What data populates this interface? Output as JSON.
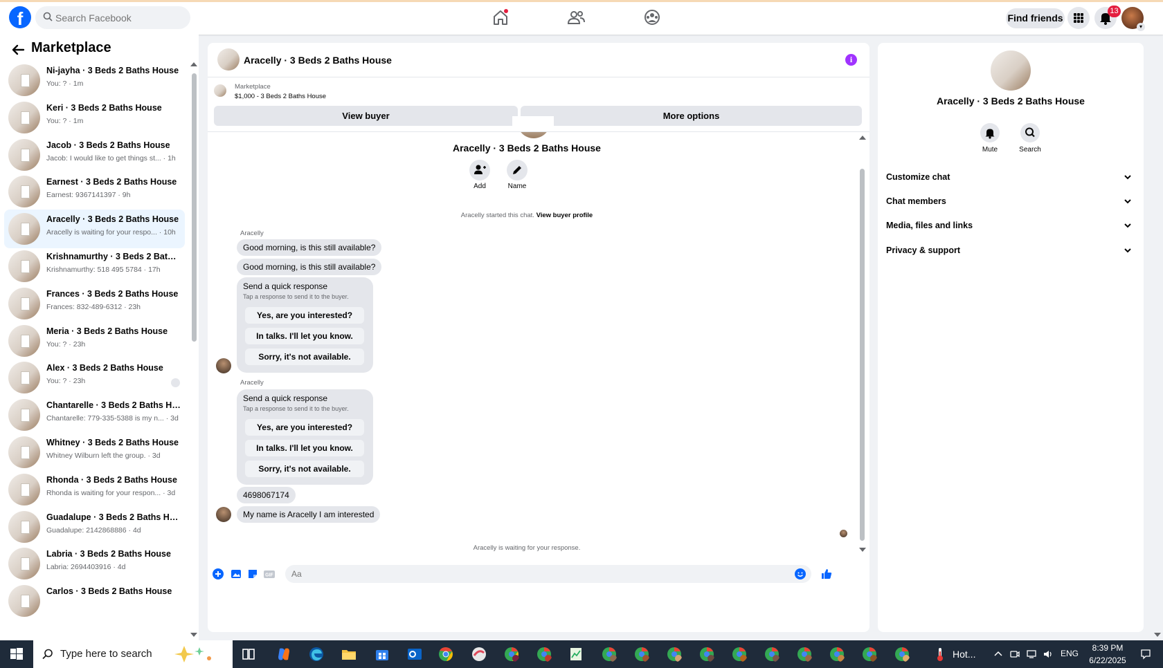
{
  "topbar": {
    "search_placeholder": "Search Facebook",
    "find_friends": "Find friends",
    "notification_count": "13",
    "brand_color": "#0866ff"
  },
  "sidebar": {
    "title": "Marketplace",
    "conversations": [
      {
        "title": "Ni-jayha · 3 Beds 2 Baths House",
        "subtitle": "You: ? · 1m"
      },
      {
        "title": "Keri · 3 Beds 2 Baths House",
        "subtitle": "You: ? · 1m"
      },
      {
        "title": "Jacob · 3 Beds 2 Baths House",
        "subtitle": "Jacob: I would like to get things st... · 1h"
      },
      {
        "title": "Earnest · 3 Beds 2 Baths House",
        "subtitle": "Earnest: 9367141397 · 9h"
      },
      {
        "title": "Aracelly · 3 Beds 2 Baths House",
        "subtitle": "Aracelly is waiting for your respo... · 10h"
      },
      {
        "title": "Krishnamurthy · 3 Beds 2 Baths ...",
        "subtitle": "Krishnamurthy: 518 495 5784 · 17h"
      },
      {
        "title": "Frances · 3 Beds 2 Baths House",
        "subtitle": "Frances: 832-489-6312 · 23h"
      },
      {
        "title": "Meria · 3 Beds 2 Baths House",
        "subtitle": "You: ? · 23h"
      },
      {
        "title": "Alex · 3 Beds 2 Baths House",
        "subtitle": "You: ? · 23h"
      },
      {
        "title": "Chantarelle · 3 Beds 2 Baths Ho...",
        "subtitle": "Chantarelle: 779-335-5388 is my n... · 3d"
      },
      {
        "title": "Whitney · 3 Beds 2 Baths House",
        "subtitle": "Whitney Wilburn left the group. · 3d"
      },
      {
        "title": "Rhonda · 3 Beds 2 Baths House",
        "subtitle": "Rhonda is waiting for your respon... · 3d"
      },
      {
        "title": "Guadalupe · 3 Beds 2 Baths Ho...",
        "subtitle": "Guadalupe: 2142868886 · 4d"
      },
      {
        "title": "Labria · 3 Beds 2 Baths House",
        "subtitle": "Labria: 2694403916 · 4d"
      },
      {
        "title": "Carlos · 3 Beds 2 Baths House",
        "subtitle": ""
      }
    ]
  },
  "chat": {
    "title": "Aracelly · 3 Beds 2 Baths House",
    "listing_source": "Marketplace",
    "listing_price": "$1,000 - 3 Beds 2 Baths House",
    "view_buyer": "View buyer",
    "more_options": "More options",
    "center_name": "Aracelly · 3 Beds 2 Baths House",
    "add_label": "Add",
    "name_label": "Name",
    "started_text": "Aracelly started this chat.",
    "view_buyer_profile": "View buyer profile",
    "sender_name": "Aracelly",
    "message_1": "Good morning, is this still available?",
    "message_2": "Good morning, is this still available?",
    "quick_title": "Send a quick response",
    "quick_sub": "Tap a response to send it to the buyer.",
    "quick_options": [
      "Yes, are you interested?",
      "In talks. I'll let you know.",
      "Sorry, it's not available."
    ],
    "message_3": "4698067174",
    "message_4": "My name is Aracelly I am interested",
    "waiting_text": "Aracelly is waiting for your response.",
    "composer_placeholder": "Aa",
    "accent_color": "#0866ff"
  },
  "info_panel": {
    "name": "Aracelly · 3 Beds 2 Baths House",
    "mute_label": "Mute",
    "search_label": "Search",
    "sections": [
      "Customize chat",
      "Chat members",
      "Media, files and links",
      "Privacy & support"
    ]
  },
  "taskbar": {
    "search_placeholder": "Type here to search",
    "weather": "Hot...",
    "language": "ENG",
    "time": "8:39 PM",
    "date": "6/22/2025"
  }
}
